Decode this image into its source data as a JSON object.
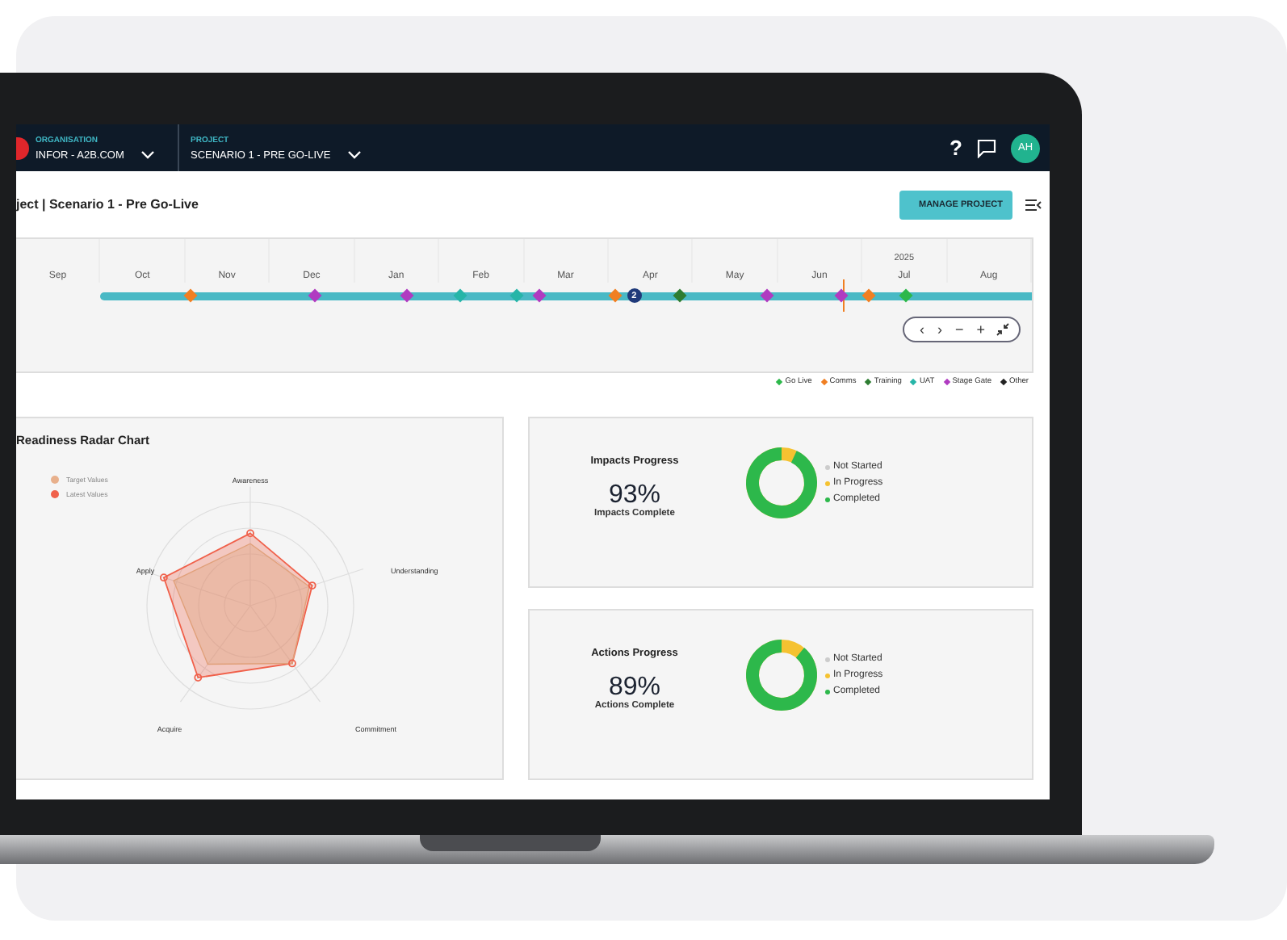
{
  "header": {
    "organisation": {
      "label": "ORGANISATION",
      "value": "INFOR - A2B.COM"
    },
    "project": {
      "label": "PROJECT",
      "value": "SCENARIO 1 - PRE GO-LIVE"
    },
    "help": "?",
    "avatar": "AH"
  },
  "page": {
    "title": "ject | Scenario 1 - Pre Go-Live",
    "manage_button": "MANAGE PROJECT"
  },
  "timeline": {
    "months": [
      {
        "label": "Sep"
      },
      {
        "label": "Oct"
      },
      {
        "label": "Nov"
      },
      {
        "label": "Dec"
      },
      {
        "label": "Jan"
      },
      {
        "label": "Feb"
      },
      {
        "label": "Mar"
      },
      {
        "label": "Apr"
      },
      {
        "label": "May"
      },
      {
        "label": "Jun"
      },
      {
        "label": "Jul",
        "year": "2025"
      },
      {
        "label": "Aug"
      }
    ],
    "today": {
      "level": 0.797
    },
    "markers": [
      {
        "kind": "diamond",
        "color": "#f07f22",
        "level": 0.097
      },
      {
        "kind": "diamond",
        "color": "#b03bc1",
        "level": 0.23
      },
      {
        "kind": "diamond",
        "color": "#b03bc1",
        "level": 0.33
      },
      {
        "kind": "diamond",
        "color": "#26b5a8",
        "level": 0.386
      },
      {
        "kind": "diamond",
        "color": "#26b5a8",
        "level": 0.448
      },
      {
        "kind": "diamond",
        "color": "#b03bc1",
        "level": 0.472
      },
      {
        "kind": "diamond",
        "color": "#f07f22",
        "level": 0.552
      },
      {
        "kind": "cluster",
        "count": "2",
        "color": "#1f3a7a",
        "level": 0.573
      },
      {
        "kind": "diamond",
        "color": "#2e7d32",
        "level": 0.623
      },
      {
        "kind": "diamond",
        "color": "#b03bc1",
        "level": 0.716
      },
      {
        "kind": "diamond",
        "color": "#b03bc1",
        "level": 0.796
      },
      {
        "kind": "diamond",
        "color": "#f07f22",
        "level": 0.825
      },
      {
        "kind": "diamond",
        "color": "#2db84b",
        "level": 0.865
      }
    ],
    "controls": [
      {
        "kind": "text",
        "label": "‹"
      },
      {
        "kind": "text",
        "label": "›"
      },
      {
        "kind": "text",
        "label": "−"
      },
      {
        "kind": "text",
        "label": "+"
      },
      {
        "kind": "collapse"
      }
    ],
    "legend": [
      {
        "label": "Go Live",
        "color": "#2db84b"
      },
      {
        "label": "Comms",
        "color": "#f07f22"
      },
      {
        "label": "Training",
        "color": "#2e7d32"
      },
      {
        "label": "UAT",
        "color": "#26b5a8"
      },
      {
        "label": "Stage Gate",
        "color": "#b03bc1"
      },
      {
        "label": "Other",
        "color": "#222222"
      }
    ]
  },
  "radar": {
    "title": "Readiness Radar Chart",
    "legend": [
      {
        "label": "Target Values",
        "color": "#e8b08c"
      },
      {
        "label": "Latest Values",
        "color": "#f0604a"
      }
    ],
    "axes": [
      "Awareness",
      "Understanding",
      "Commitment",
      "Acquire",
      "Apply"
    ]
  },
  "progress": [
    {
      "title": "Impacts Progress",
      "percent": "93%",
      "caption": "Impacts Complete",
      "legend": [
        {
          "label": "Not Started",
          "color": "#cccccc"
        },
        {
          "label": "In Progress",
          "color": "#f5c231"
        },
        {
          "label": "Completed",
          "color": "#2db84b"
        }
      ]
    },
    {
      "title": "Actions Progress",
      "percent": "89%",
      "caption": "Actions Complete",
      "legend": [
        {
          "label": "Not Started",
          "color": "#cccccc"
        },
        {
          "label": "In Progress",
          "color": "#f5c231"
        },
        {
          "label": "Completed",
          "color": "#2db84b"
        }
      ]
    }
  ]
}
